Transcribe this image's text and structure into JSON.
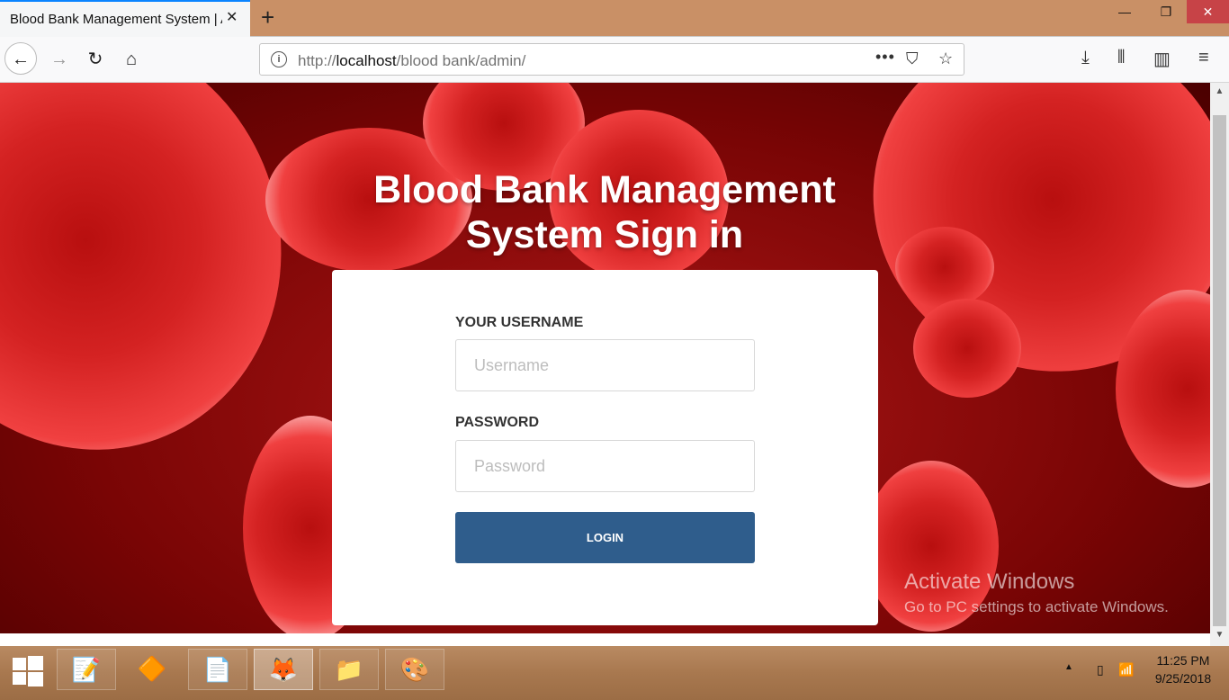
{
  "browser": {
    "tab_title": "Blood Bank Management System | A",
    "tab_close": "✕",
    "new_tab": "+",
    "url_scheme": "http://",
    "url_host": "localhost",
    "url_path": "/blood bank/admin/",
    "window_controls": {
      "minimize": "—",
      "maximize": "❐",
      "close": "✕"
    },
    "icons": {
      "back": "arrow-left-icon",
      "forward": "arrow-right-icon",
      "reload": "reload-icon",
      "home": "home-icon",
      "info": "info-icon",
      "more": "more-dots-icon",
      "pocket": "pocket-icon",
      "bookmark": "star-icon",
      "downloads": "download-icon",
      "library": "library-icon",
      "sidebar": "sidebar-icon",
      "menu": "hamburger-menu-icon"
    }
  },
  "page": {
    "title_line1": "Blood Bank Management",
    "title_line2": "System Sign in",
    "form": {
      "username_label": "YOUR USERNAME",
      "username_placeholder": "Username",
      "password_label": "PASSWORD",
      "password_placeholder": "Password",
      "login_label": "LOGIN"
    },
    "watermark": {
      "title": "Activate Windows",
      "subtitle": "Go to PC settings to activate Windows."
    },
    "colors": {
      "button": "#2f5d8c",
      "background": "#b01818",
      "titlebar": "#c99066"
    }
  },
  "taskbar": {
    "apps": [
      "notepad-icon",
      "vlc-icon",
      "word-icon",
      "firefox-icon",
      "folder-icon",
      "paint-icon"
    ],
    "time": "11:25 PM",
    "date": "9/25/2018"
  }
}
